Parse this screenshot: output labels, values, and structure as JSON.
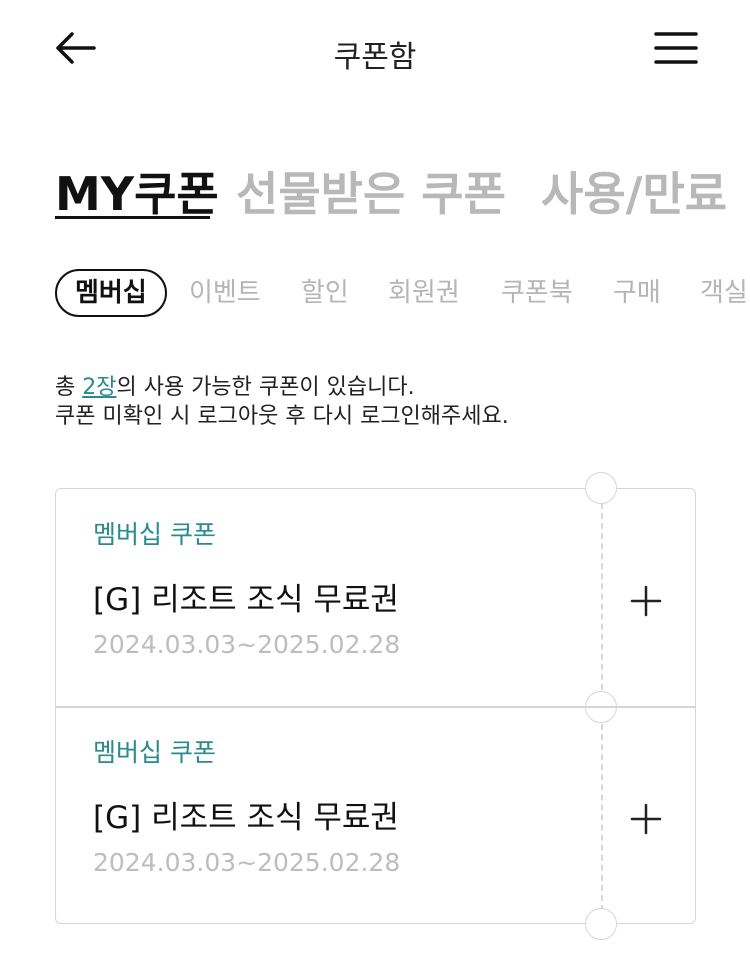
{
  "header": {
    "title": "쿠폰함",
    "back_icon": "arrow-left-icon",
    "menu_icon": "hamburger-menu-icon"
  },
  "tabs": [
    {
      "label": "MY쿠폰",
      "active": true
    },
    {
      "label": "선물받은 쿠폰",
      "active": false
    },
    {
      "label": "사용/만료",
      "active": false
    }
  ],
  "chips": [
    {
      "label": "멤버십",
      "active": true
    },
    {
      "label": "이벤트",
      "active": false
    },
    {
      "label": "할인",
      "active": false
    },
    {
      "label": "회원권",
      "active": false
    },
    {
      "label": "쿠폰북",
      "active": false
    },
    {
      "label": "구매",
      "active": false
    },
    {
      "label": "객실",
      "active": false
    }
  ],
  "info": {
    "prefix": "총 ",
    "count": "2장",
    "suffix": "의 사용 가능한 쿠폰이 있습니다.",
    "line2": "쿠폰 미확인 시 로그아웃 후 다시 로그인해주세요."
  },
  "coupons": [
    {
      "type": "멤버십 쿠폰",
      "name": "[G] 리조트 조식 무료권",
      "period": "2024.03.03~2025.02.28",
      "action_icon": "plus-icon"
    },
    {
      "type": "멤버십 쿠폰",
      "name": "[G] 리조트 조식 무료권",
      "period": "2024.03.03~2025.02.28",
      "action_icon": "plus-icon"
    }
  ],
  "colors": {
    "accent": "#2a8a8e",
    "inactive": "#b8b8b8",
    "border": "#d6d6d6"
  }
}
